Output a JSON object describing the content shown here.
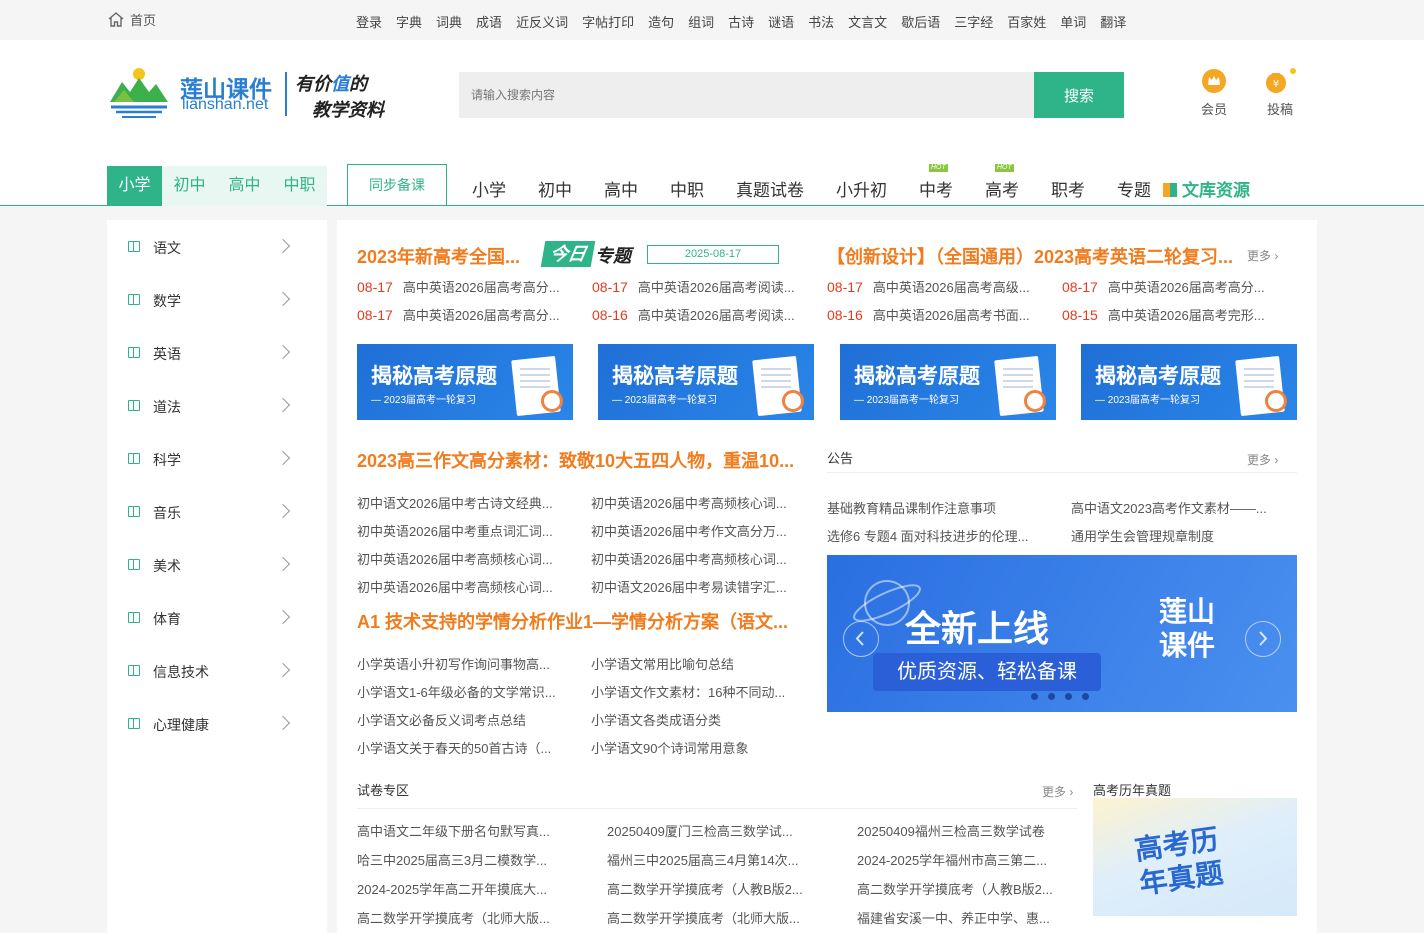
{
  "topbar": {
    "home": "首页",
    "links": [
      "登录",
      "字典",
      "词典",
      "成语",
      "近反义词",
      "字帖打印",
      "造句",
      "组词",
      "古诗",
      "谜语",
      "书法",
      "文言文",
      "歇后语",
      "三字经",
      "百家姓",
      "单词",
      "翻译"
    ]
  },
  "header": {
    "logo_cn": "莲山课件",
    "logo_en": "lianshan.net",
    "slogan_prefix": "有价",
    "slogan_highlight": "值",
    "slogan_suffix": "的",
    "slogan_line2": "教学资料",
    "search_placeholder": "请输入搜索内容",
    "search_button": "搜索",
    "member": "会员",
    "submit": "投稿"
  },
  "nav": {
    "grades": [
      "小学",
      "初中",
      "高中",
      "中职"
    ],
    "active_grade": "小学",
    "sync": "同步备课",
    "items": [
      "小学",
      "初中",
      "高中",
      "中职",
      "真题试卷",
      "小升初",
      "中考",
      "高考",
      "职考",
      "专题"
    ],
    "hot_label": "HOT",
    "wenku": "文库资源"
  },
  "sidebar": {
    "subjects": [
      "语文",
      "数学",
      "英语",
      "道法",
      "科学",
      "音乐",
      "美术",
      "体育",
      "信息技术",
      "心理健康"
    ]
  },
  "featured": {
    "title_left": "2023年新高考全国...",
    "today_a": "今日",
    "today_b": "专题",
    "date": "2025-08-17",
    "title_right": "【创新设计】（全国通用）2023高考英语二轮复习...",
    "more": "更多",
    "items": [
      {
        "date": "08-17",
        "text": "高中英语2026届高考高分..."
      },
      {
        "date": "08-17",
        "text": "高中英语2026届高考阅读..."
      },
      {
        "date": "08-17",
        "text": "高中英语2026届高考高级..."
      },
      {
        "date": "08-17",
        "text": "高中英语2026届高考高分..."
      },
      {
        "date": "08-17",
        "text": "高中英语2026届高考高分..."
      },
      {
        "date": "08-16",
        "text": "高中英语2026届高考阅读..."
      },
      {
        "date": "08-16",
        "text": "高中英语2026届高考书面..."
      },
      {
        "date": "08-15",
        "text": "高中英语2026届高考完形..."
      }
    ]
  },
  "banners": [
    {
      "title": "揭秘高考原题",
      "sub": "— 2023届高考一轮复习"
    },
    {
      "title": "揭秘高考原题",
      "sub": "— 2023届高考一轮复习"
    },
    {
      "title": "揭秘高考原题",
      "sub": "— 2023届高考一轮复习"
    },
    {
      "title": "揭秘高考原题",
      "sub": "— 2023届高考一轮复习"
    }
  ],
  "essay": {
    "title": "2023高三作文高分素材：致敬10大五四人物，重温10...",
    "items": [
      "初中语文2026届中考古诗文经典...",
      "初中英语2026届中考高频核心词...",
      "初中英语2026届中考重点词汇词...",
      "初中英语2026届中考作文高分万...",
      "初中英语2026届中考高频核心词...",
      "初中英语2026届中考高频核心词...",
      "初中英语2026届中考高频核心词...",
      "初中语文2026届中考易读错字汇..."
    ]
  },
  "ai": {
    "title": "A1 技术支持的学情分析作业1—学情分析方案（语文...",
    "items": [
      "小学英语小升初写作询问事物高...",
      "小学语文常用比喻句总结",
      "小学语文1-6年级必备的文学常识...",
      "小学语文作文素材：16种不同动...",
      "小学语文必备反义词考点总结",
      "小学语文各类成语分类",
      "小学语文关于春天的50首古诗（...",
      "小学语文90个诗词常用意象"
    ]
  },
  "notice": {
    "title": "公告",
    "more": "更多",
    "items": [
      "基础教育精品课制作注意事项",
      "高中语文2023高考作文素材——...",
      "选修6 专题4 面对科技进步的伦理...",
      "通用学生会管理规章制度"
    ]
  },
  "carousel": {
    "main": "全新上线",
    "sub": "优质资源、轻松备课",
    "brand1": "莲山",
    "brand2": "课件"
  },
  "papers": {
    "title": "试卷专区",
    "more": "更多",
    "items": [
      "高中语文二年级下册名句默写真...",
      "20250409厦门三检高三数学试...",
      "20250409福州三检高三数学试卷",
      "哈三中2025届高三3月二模数学...",
      "福州三中2025届高三4月第14次...",
      "2024-2025学年福州市高三第二...",
      "2024-2025学年高二开年摸底大...",
      "高二数学开学摸底考（人教B版2...",
      "高二数学开学摸底考（人教B版2...",
      "高二数学开学摸底考（北师大版...",
      "高二数学开学摸底考（北师大版...",
      "福建省安溪一中、养正中学、惠..."
    ]
  },
  "gaokao": {
    "title": "高考历年真题",
    "img_l1": "高考历",
    "img_l2": "年真题"
  },
  "colors": {
    "accent": "#2fb489",
    "orange": "#f07c1e",
    "blue": "#2a7ed2",
    "red": "#e63b1e"
  }
}
